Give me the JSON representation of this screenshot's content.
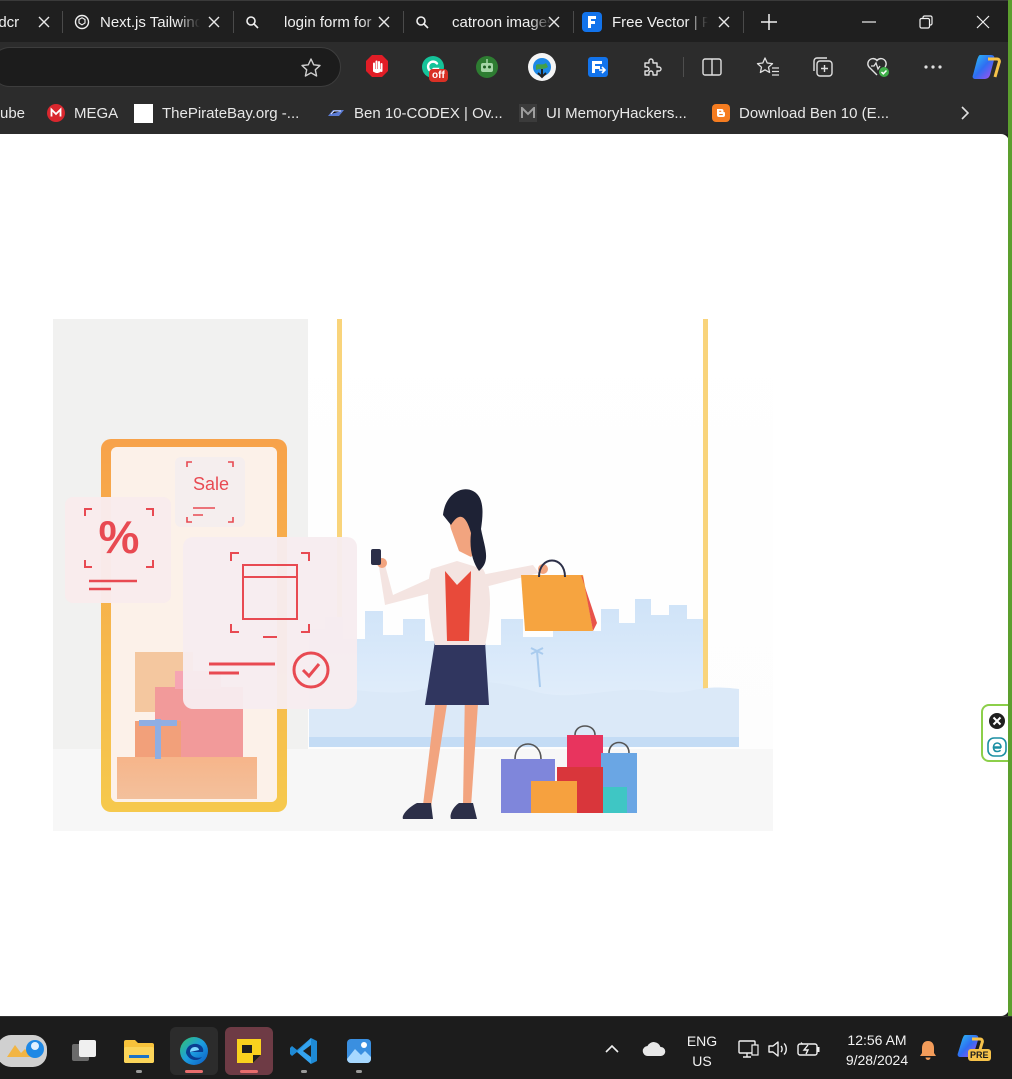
{
  "tabs": [
    {
      "title": "adcr",
      "icon": "download-icon",
      "active": false
    },
    {
      "title": "Next.js Tailwind",
      "icon": "chatgpt-icon",
      "active": false
    },
    {
      "title": "login form for",
      "icon": "search-icon",
      "active": false
    },
    {
      "title": "catroon images",
      "icon": "search-icon",
      "active": false
    },
    {
      "title": "Free Vector | F",
      "icon": "freepik-icon",
      "active": true
    }
  ],
  "bookmarks": [
    {
      "label": "ube",
      "icon": "youtube-icon"
    },
    {
      "label": "MEGA",
      "icon": "mega-icon"
    },
    {
      "label": "ThePirateBay.org -...",
      "icon": "blank-page-icon"
    },
    {
      "label": "Ben 10-CODEX | Ov...",
      "icon": "codex-icon"
    },
    {
      "label": "UI MemoryHackers...",
      "icon": "m-logo-icon"
    },
    {
      "label": "Download Ben 10 (E...",
      "icon": "blogger-icon"
    }
  ],
  "extensions": {
    "off_badge": "off"
  },
  "illustration": {
    "sale_text": "Sale",
    "percent_text": "%"
  },
  "taskbar": {
    "language_line1": "ENG",
    "language_line2": "US",
    "time": "12:56 AM",
    "date": "9/28/2024",
    "copilot_badge": "PRE"
  },
  "colors": {
    "accent_red": "#e84a52",
    "window_border": "#5c9f2e"
  }
}
